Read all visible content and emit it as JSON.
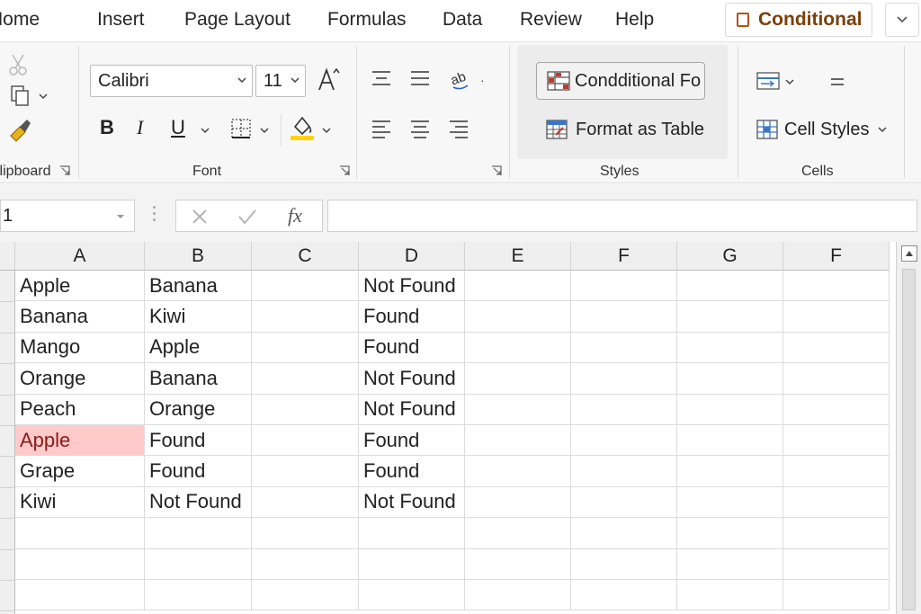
{
  "tabs": [
    "Home",
    "Insert",
    "Page Layout",
    "Formulas",
    "Data",
    "Review",
    "Help"
  ],
  "tab_home_visible": "Home",
  "conditional_tab": "Conditional",
  "clipboard": {
    "label": "Clipboard"
  },
  "font": {
    "label": "Font",
    "name": "Calibri",
    "size": "11",
    "bold": "B",
    "italic": "I",
    "underline": "U"
  },
  "styles": {
    "label": "Styles",
    "conditional_formatting": "Condditional Fo",
    "format_as_table": "Format as Table"
  },
  "cells": {
    "label": "Cells",
    "cell_styles": "Cell Styles"
  },
  "formula_bar": {
    "name_box": "1",
    "fx": "fx",
    "value": ""
  },
  "grid": {
    "columns": [
      "A",
      "B",
      "C",
      "D",
      "E",
      "F",
      "G",
      "F"
    ],
    "rows": [
      [
        "Apple",
        "Banana",
        "",
        "Not Found"
      ],
      [
        "Banana",
        "Kiwi",
        "",
        "Found"
      ],
      [
        "Mango",
        "Apple",
        "",
        "Found"
      ],
      [
        "Orange",
        "Banana",
        "",
        "Not Found"
      ],
      [
        "Peach",
        "Orange",
        "",
        "Not Found"
      ],
      [
        "Apple",
        "Found",
        "",
        "Found"
      ],
      [
        "Grape",
        "Found",
        "",
        "Found"
      ],
      [
        "Kiwi",
        "Not Found",
        "",
        "Not Found"
      ]
    ],
    "highlight_cell": "A6",
    "highlight_color": "#fecaca"
  },
  "colors": {
    "accent": "#7b3f0a",
    "ribbon_bg": "#f7f7f7",
    "fill_yellow": "#ffd400",
    "cf_red": "#c0392b"
  }
}
